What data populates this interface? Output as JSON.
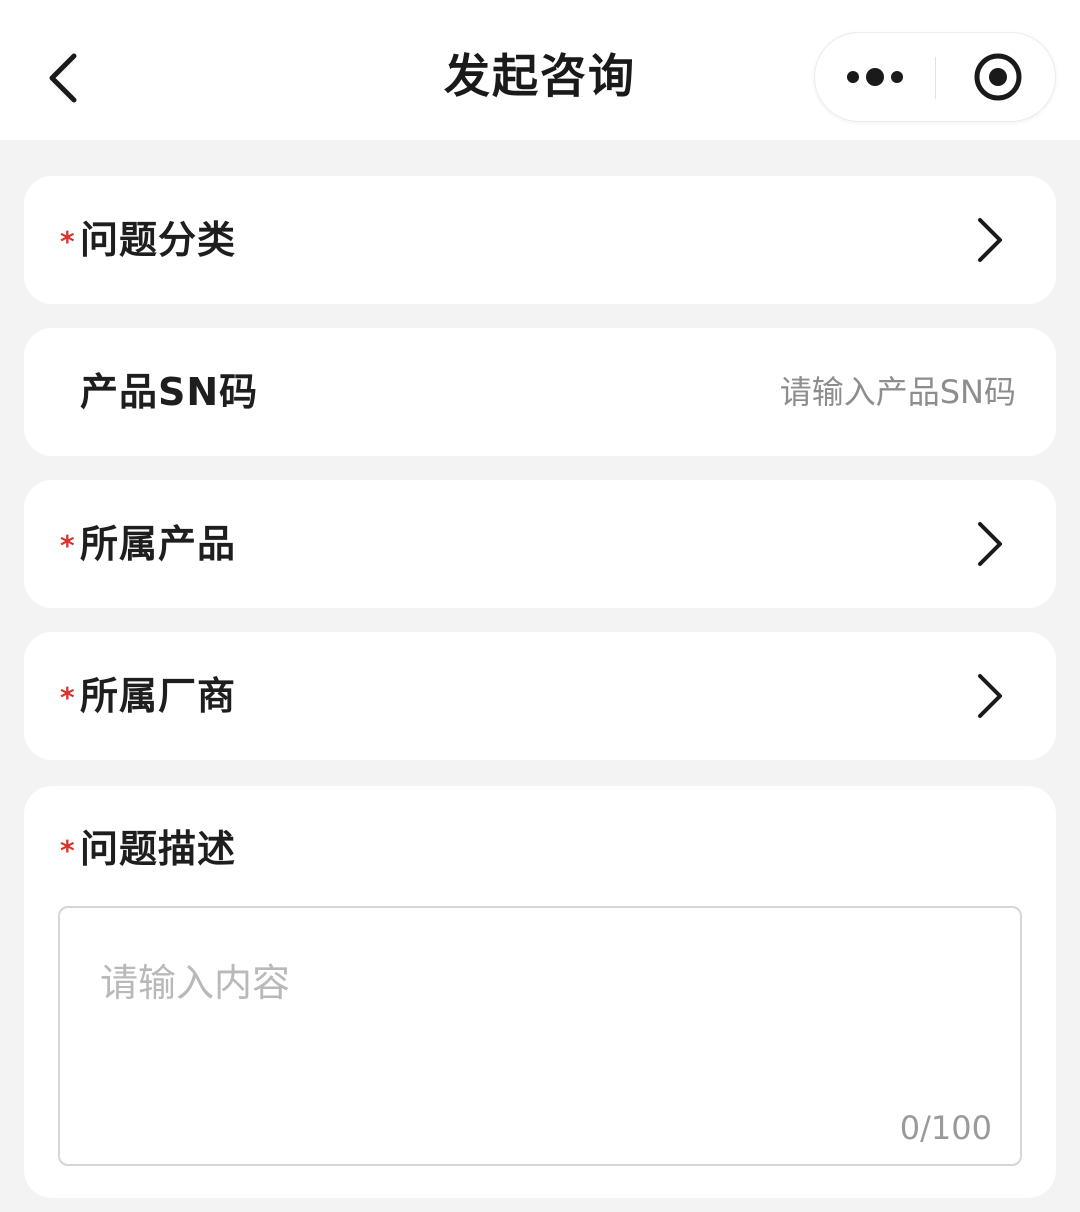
{
  "header": {
    "title": "发起咨询",
    "back_icon": "chevron-left-icon",
    "more_icon": "more-dots-icon",
    "close_icon": "target-circle-icon"
  },
  "form": {
    "required_mark": "*",
    "category": {
      "label": "问题分类",
      "required": true
    },
    "sn": {
      "label": "产品SN码",
      "placeholder": "请输入产品SN码",
      "value": "",
      "required": false
    },
    "product": {
      "label": "所属产品",
      "required": true
    },
    "vendor": {
      "label": "所属厂商",
      "required": true
    },
    "description": {
      "label": "问题描述",
      "placeholder": "请输入内容",
      "value": "",
      "counter": "0/100",
      "required": true
    }
  },
  "colors": {
    "background": "#f3f3f3",
    "card": "#ffffff",
    "required": "#d9342b",
    "placeholder": "#8d8d8d"
  }
}
